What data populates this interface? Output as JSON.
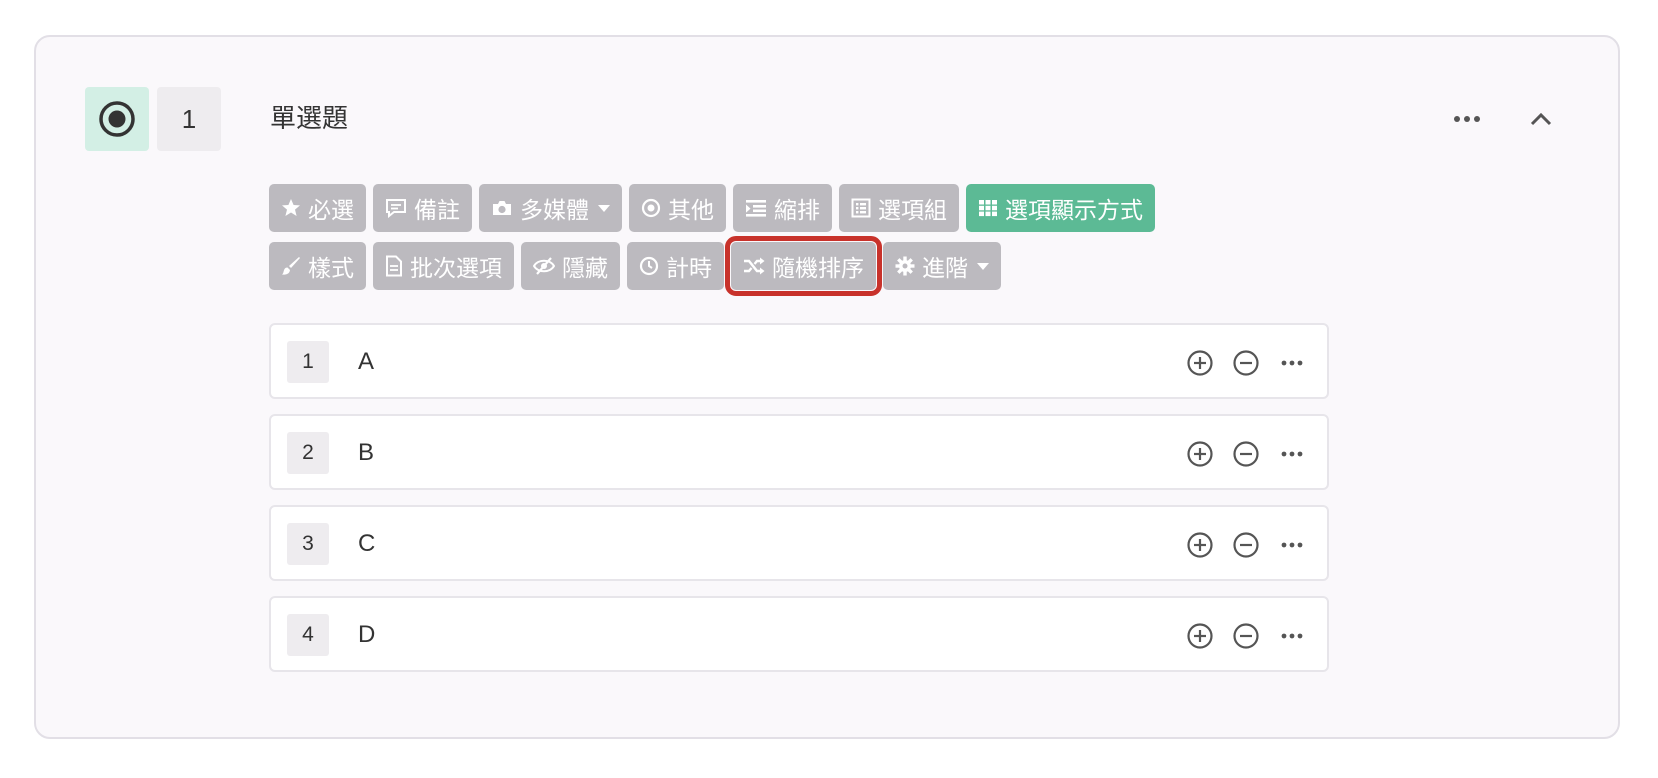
{
  "question": {
    "number": "1",
    "title": "單選題",
    "type_icon": "radio-selected-icon"
  },
  "header_actions": {
    "more_icon": "more-horizontal-icon",
    "collapse_icon": "chevron-up-icon"
  },
  "toolbar": {
    "row1": [
      {
        "label": "必選",
        "icon": "star-icon"
      },
      {
        "label": "備註",
        "icon": "comment-icon"
      },
      {
        "label": "多媒體",
        "icon": "camera-icon",
        "dropdown": true
      },
      {
        "label": "其他",
        "icon": "radio-dot-icon"
      },
      {
        "label": "縮排",
        "icon": "indent-icon"
      },
      {
        "label": "選項組",
        "icon": "list-box-icon"
      },
      {
        "label": "選項顯示方式",
        "icon": "grid-icon",
        "active": true
      }
    ],
    "row2": [
      {
        "label": "樣式",
        "icon": "brush-icon"
      },
      {
        "label": "批次選項",
        "icon": "document-icon"
      },
      {
        "label": "隱藏",
        "icon": "eye-slash-icon"
      },
      {
        "label": "計時",
        "icon": "clock-icon"
      },
      {
        "label": "隨機排序",
        "icon": "shuffle-icon",
        "highlighted": true
      },
      {
        "label": "進階",
        "icon": "gear-icon",
        "dropdown": true
      }
    ]
  },
  "options": [
    {
      "number": "1",
      "text": "A"
    },
    {
      "number": "2",
      "text": "B"
    },
    {
      "number": "3",
      "text": "C"
    },
    {
      "number": "4",
      "text": "D"
    }
  ],
  "colors": {
    "button_gray": "#bcbabf",
    "button_green": "#5cba95",
    "highlight_red": "#c8322b",
    "type_icon_bg": "#d3efe5"
  }
}
